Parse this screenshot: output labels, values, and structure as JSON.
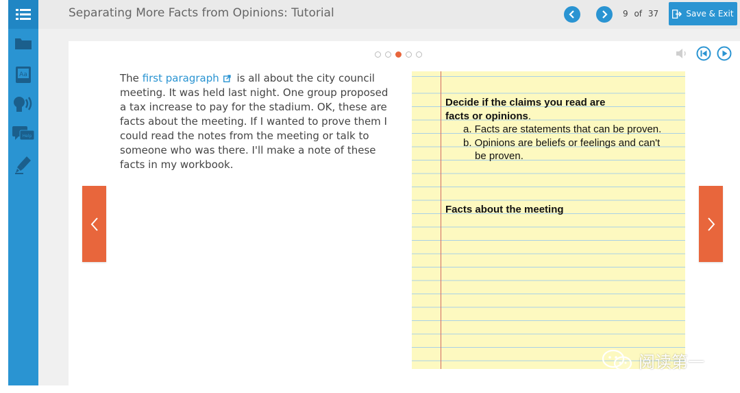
{
  "header": {
    "title": "Separating More Facts from Opinions: Tutorial",
    "page_current": "9",
    "page_of": "of",
    "page_total": "37",
    "save_label": "Save & Exit"
  },
  "sidebar": {
    "items": [
      {
        "icon": "list-icon"
      },
      {
        "icon": "folder-icon"
      },
      {
        "icon": "glossary-icon"
      },
      {
        "icon": "speech-icon"
      },
      {
        "icon": "chat-help-icon"
      },
      {
        "icon": "highlighter-icon"
      }
    ]
  },
  "pagination": {
    "total_dots": 5,
    "active_index": 2
  },
  "passage": {
    "prefix": "The",
    "link_text": "first paragraph",
    "suffix": "is all about the city council meeting. It was held last night. One group proposed a tax increase to pay for the stadium. OK, these are facts about the meeting. If I wanted to prove them I could read the notes from the meeting or talk to someone who was there. I'll make a note of these facts in my workbook."
  },
  "notepad": {
    "line1": "Decide if the claims you read are",
    "line2_bold": "facts or opinions",
    "line2_end": ".",
    "item_a": "a. Facts are statements that can be proven.",
    "item_b_1": "b. Opinions are beliefs or feelings and can't",
    "item_b_2": "be proven.",
    "facts_heading": "Facts about the meeting"
  },
  "watermark": {
    "text": "阅读第一"
  },
  "colors": {
    "sidebar": "#2a94d2",
    "accent_orange": "#e8663c",
    "notepad_yellow": "#fdf9c0",
    "notepad_rule": "#a9d1e6",
    "margin_red": "#d36a5f"
  }
}
